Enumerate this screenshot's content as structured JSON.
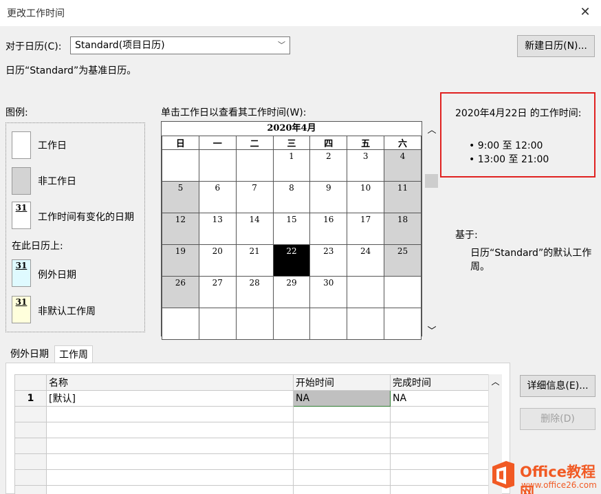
{
  "window": {
    "title": "更改工作时间"
  },
  "calendar_select": {
    "label": "对于日历(C):",
    "value": "Standard(项目日历)"
  },
  "new_calendar_button": "新建日历(N)...",
  "base_note": "日历“Standard”为基准日历。",
  "legend": {
    "heading": "图例:",
    "working_day": "工作日",
    "nonworking_day": "非工作日",
    "changed_day": "工作时间有变化的日期",
    "on_this_calendar": "在此日历上:",
    "exception_day": "例外日期",
    "nondefault_week": "非默认工作周",
    "swatch_number": "31"
  },
  "calendar": {
    "instruction": "单击工作日以查看其工作时间(W):",
    "month_title": "2020年4月",
    "weekdays": [
      "日",
      "一",
      "二",
      "三",
      "四",
      "五",
      "六"
    ],
    "weeks": [
      [
        "",
        "",
        "",
        "1",
        "2",
        "3",
        "4"
      ],
      [
        "5",
        "6",
        "7",
        "8",
        "9",
        "10",
        "11"
      ],
      [
        "12",
        "13",
        "14",
        "15",
        "16",
        "17",
        "18"
      ],
      [
        "19",
        "20",
        "21",
        "22",
        "23",
        "24",
        "25"
      ],
      [
        "26",
        "27",
        "28",
        "29",
        "30",
        "",
        ""
      ],
      [
        "",
        "",
        "",
        "",
        "",
        "",
        ""
      ]
    ],
    "selected_day": "22"
  },
  "working_times": {
    "heading": "2020年4月22日 的工作时间:",
    "items": [
      "• 9:00 至 12:00",
      "• 13:00 至 21:00"
    ]
  },
  "based_on": {
    "heading": "基于:",
    "text_line1": "日历“Standard”的默认工作",
    "text_line2": "周。"
  },
  "tabs": [
    "例外日期",
    "工作周"
  ],
  "grid": {
    "headers": [
      "名称",
      "开始时间",
      "完成时间"
    ],
    "rows": [
      {
        "num": "1",
        "name": "[默认]",
        "start": "NA",
        "finish": "NA"
      }
    ]
  },
  "buttons": {
    "details": "详细信息(E)...",
    "delete": "删除(D)"
  },
  "watermark": {
    "brand": "Office教程网",
    "url": "www.office26.com"
  },
  "colors": {
    "highlight_border": "#e0201f",
    "nonworking": "#d3d3d3",
    "selected": "#000000",
    "exception_swatch": "#dffaff",
    "nondefault_swatch": "#ffffdc",
    "logo_orange": "#f15a24"
  }
}
